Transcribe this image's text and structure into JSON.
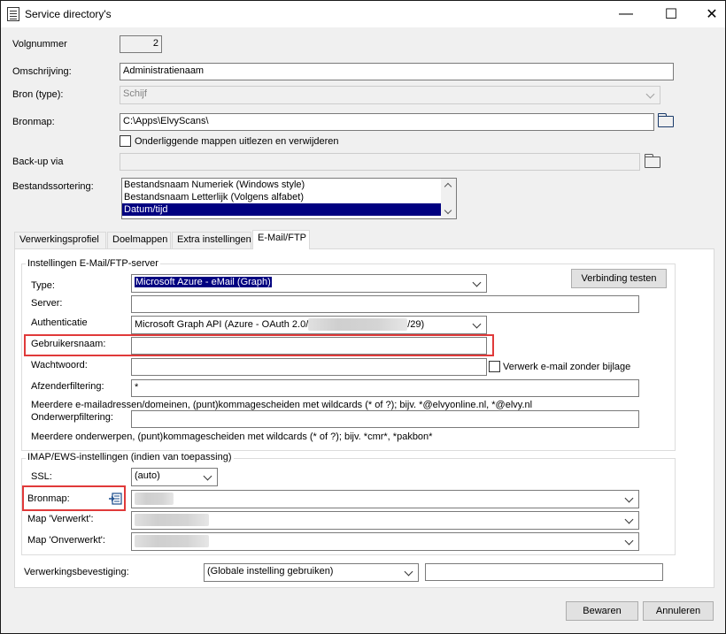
{
  "window": {
    "title": "Service directory's",
    "minimize": "—",
    "maximize": "☐",
    "close": "✕"
  },
  "form": {
    "volgnummer_label": "Volgnummer",
    "volgnummer_value": "2",
    "omschrijving_label": "Omschrijving:",
    "omschrijving_value": "Administratienaam",
    "bron_label": "Bron (type):",
    "bron_value": "Schijf",
    "bronmap_label": "Bronmap:",
    "bronmap_value": "C:\\Apps\\ElvyScans\\",
    "onderliggende_label": "Onderliggende mappen uitlezen en verwijderen",
    "backup_label": "Back-up via",
    "backup_value": "",
    "sortering_label": "Bestandssortering:",
    "sortering_items": [
      "Bestandsnaam Numeriek (Windows style)",
      "Bestandsnaam Letterlijk (Volgens alfabet)",
      "Datum/tijd"
    ],
    "sortering_selected_index": 2
  },
  "tabs": [
    "Verwerkingsprofiel",
    "Doelmappen",
    "Extra instellingen",
    "E-Mail/FTP"
  ],
  "active_tab": "E-Mail/FTP",
  "email_group": {
    "title": "Instellingen E-Mail/FTP-server",
    "type_label": "Type:",
    "type_value": "Microsoft Azure - eMail (Graph)",
    "test_button": "Verbinding testen",
    "server_label": "Server:",
    "server_value": "",
    "auth_label": "Authenticatie",
    "auth_value_prefix": "Microsoft Graph API (Azure - OAuth 2.0/",
    "auth_value_suffix": "/29)",
    "gebruiker_label": "Gebruikersnaam:",
    "gebruiker_value": "",
    "wachtwoord_label": "Wachtwoord:",
    "wachtwoord_value": "",
    "zonder_bijlage_label": "Verwerk e-mail zonder bijlage",
    "afzender_label": "Afzenderfiltering:",
    "afzender_value": "*",
    "afzender_hint": "Meerdere e-mailadressen/domeinen, (punt)kommagescheiden met wildcards (* of ?); bijv. *@elvyonline.nl, *@elvy.nl",
    "onderwerp_label": "Onderwerpfiltering:",
    "onderwerp_value": "",
    "onderwerp_hint": "Meerdere onderwerpen, (punt)kommagescheiden met wildcards (* of ?); bijv. *cmr*, *pakbon*"
  },
  "imap_group": {
    "title": "IMAP/EWS-instellingen (indien van toepassing)",
    "ssl_label": "SSL:",
    "ssl_value": "(auto)",
    "bronmap_label": "Bronmap:",
    "verwerkt_label": "Map 'Verwerkt':",
    "onverwerkt_label": "Map 'Onverwerkt':"
  },
  "bevestiging_label": "Verwerkingsbevestiging:",
  "bevestiging_value": "(Globale instelling gebruiken)",
  "buttons": {
    "save": "Bewaren",
    "cancel": "Annuleren"
  }
}
